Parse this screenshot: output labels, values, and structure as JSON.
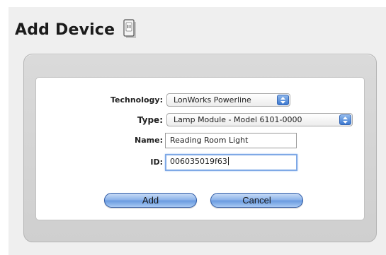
{
  "header": {
    "title": "Add Device"
  },
  "form": {
    "technology": {
      "label": "Technology:",
      "value": "LonWorks Powerline"
    },
    "type": {
      "label": "Type:",
      "value": "Lamp Module - Model 6101-0000"
    },
    "name": {
      "label": "Name:",
      "value": "Reading Room Light"
    },
    "id": {
      "label": "ID:",
      "value": "006035019f63"
    }
  },
  "buttons": {
    "add_label": "Add",
    "cancel_label": "Cancel"
  },
  "icons": {
    "title_icon": "device-module-icon",
    "select_arrows": "chevron-up-down-icon"
  }
}
